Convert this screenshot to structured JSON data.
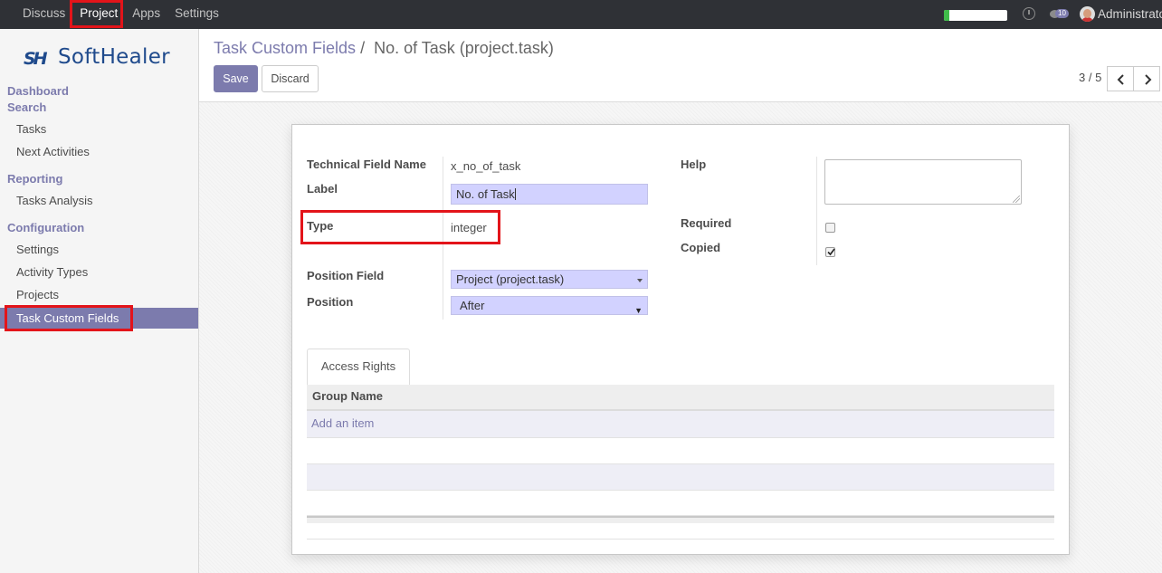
{
  "topbar": {
    "menu": [
      "Discuss",
      "Project",
      "Apps",
      "Settings"
    ],
    "active_menu": "Project",
    "activity_progress_percent": 8,
    "message_count": "10",
    "username": "Administrator"
  },
  "brand": {
    "logo_mark": "SH",
    "logo_text": "SoftHealer"
  },
  "sidebar": {
    "sections": [
      {
        "title": "Dashboard",
        "items": []
      },
      {
        "title": "Search",
        "items": [
          "Tasks",
          "Next Activities"
        ]
      },
      {
        "title": "Reporting",
        "items": [
          "Tasks Analysis"
        ]
      },
      {
        "title": "Configuration",
        "items": [
          "Settings",
          "Activity Types",
          "Projects",
          "Task Custom Fields"
        ]
      }
    ],
    "selected_item": "Task Custom Fields"
  },
  "breadcrumb": {
    "parent": "Task Custom Fields",
    "separator": "/",
    "current": "No. of Task (project.task)"
  },
  "toolbar": {
    "save_label": "Save",
    "discard_label": "Discard"
  },
  "pager": {
    "text": "3 / 5"
  },
  "form": {
    "technical_field_name": {
      "label": "Technical Field Name",
      "value": "x_no_of_task"
    },
    "label_field": {
      "label": "Label",
      "value": "No. of Task"
    },
    "type": {
      "label": "Type",
      "value": "integer"
    },
    "position_field": {
      "label": "Position Field",
      "value": "Project (project.task)"
    },
    "position": {
      "label": "Position",
      "value": "After"
    },
    "help": {
      "label": "Help",
      "value": ""
    },
    "required": {
      "label": "Required",
      "checked": false
    },
    "copied": {
      "label": "Copied",
      "checked": true
    }
  },
  "tabs": {
    "access_rights": "Access Rights"
  },
  "access_table": {
    "column": "Group Name",
    "add_item": "Add an item"
  },
  "colors": {
    "accent": "#7c7bad",
    "highlight_red": "#e3141a",
    "topbar_bg": "#2f3136",
    "input_bg": "#d2d2ff"
  }
}
